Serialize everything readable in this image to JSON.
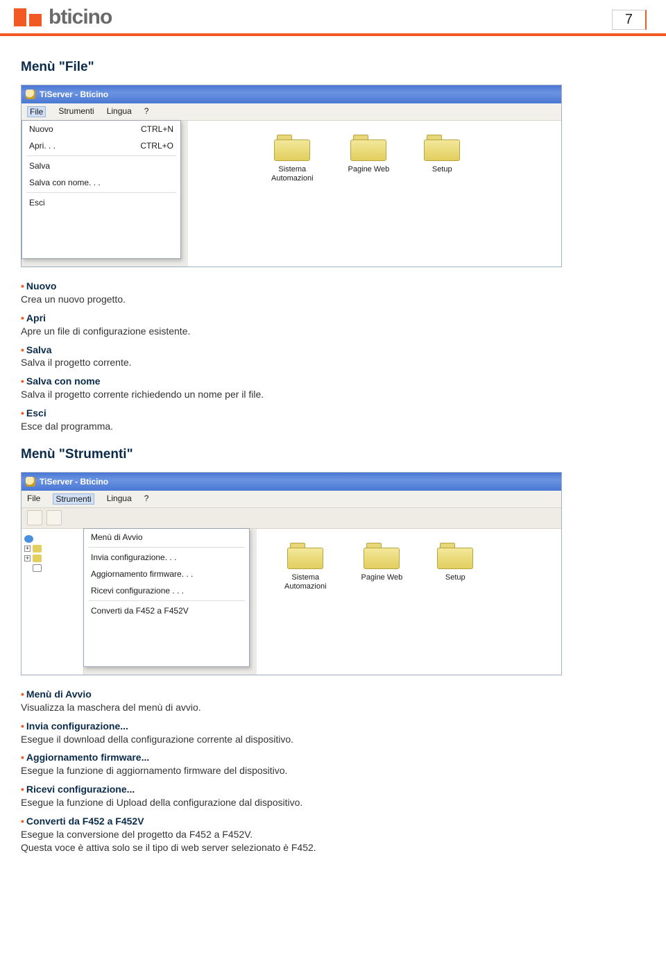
{
  "page_number": "7",
  "brand_logo_text": "bticino",
  "section1_title": "Menù \"File\"",
  "section2_title": "Menù \"Strumenti\"",
  "window_title": "TiServer - Bticino",
  "menubar": {
    "file": "File",
    "strumenti": "Strumenti",
    "lingua": "Lingua",
    "help": "?"
  },
  "file_menu": {
    "nuovo": "Nuovo",
    "nuovo_sc": "CTRL+N",
    "apri": "Apri. . .",
    "apri_sc": "CTRL+O",
    "salva": "Salva",
    "salva_con_nome": "Salva con nome. . .",
    "esci": "Esci"
  },
  "strumenti_menu": {
    "avvio": "Menù di Avvio",
    "invia": "Invia configurazione. . .",
    "agg_fw": "Aggiornamento firmware. . .",
    "ricevi": "Ricevi configurazione . . .",
    "converti": "Converti da F452 a F452V"
  },
  "folders": {
    "sistema": "Sistema\nAutomazioni",
    "pagine": "Pagine Web",
    "setup": "Setup"
  },
  "desc_file": [
    {
      "term": "Nuovo",
      "text": "Crea un nuovo progetto."
    },
    {
      "term": "Apri",
      "text": "Apre un file di configurazione esistente."
    },
    {
      "term": "Salva",
      "text": "Salva il progetto corrente."
    },
    {
      "term": "Salva con nome",
      "text": "Salva il progetto corrente richiedendo un nome per il file."
    },
    {
      "term": "Esci",
      "text": "Esce dal programma."
    }
  ],
  "desc_strumenti": [
    {
      "term": "Menù di Avvio",
      "text": "Visualizza la maschera del menù di avvio."
    },
    {
      "term": "Invia configurazione...",
      "text": "Esegue il download della configurazione corrente al dispositivo."
    },
    {
      "term": "Aggiornamento firmware...",
      "text": "Esegue la funzione di aggiornamento firmware del dispositivo."
    },
    {
      "term": "Ricevi configurazione...",
      "text": "Esegue la funzione di Upload della configurazione dal dispositivo."
    },
    {
      "term": "Converti da F452 a F452V",
      "text": "Esegue la conversione del progetto da F452 a F452V.\nQuesta voce è attiva solo se il tipo di web server selezionato è F452."
    }
  ]
}
